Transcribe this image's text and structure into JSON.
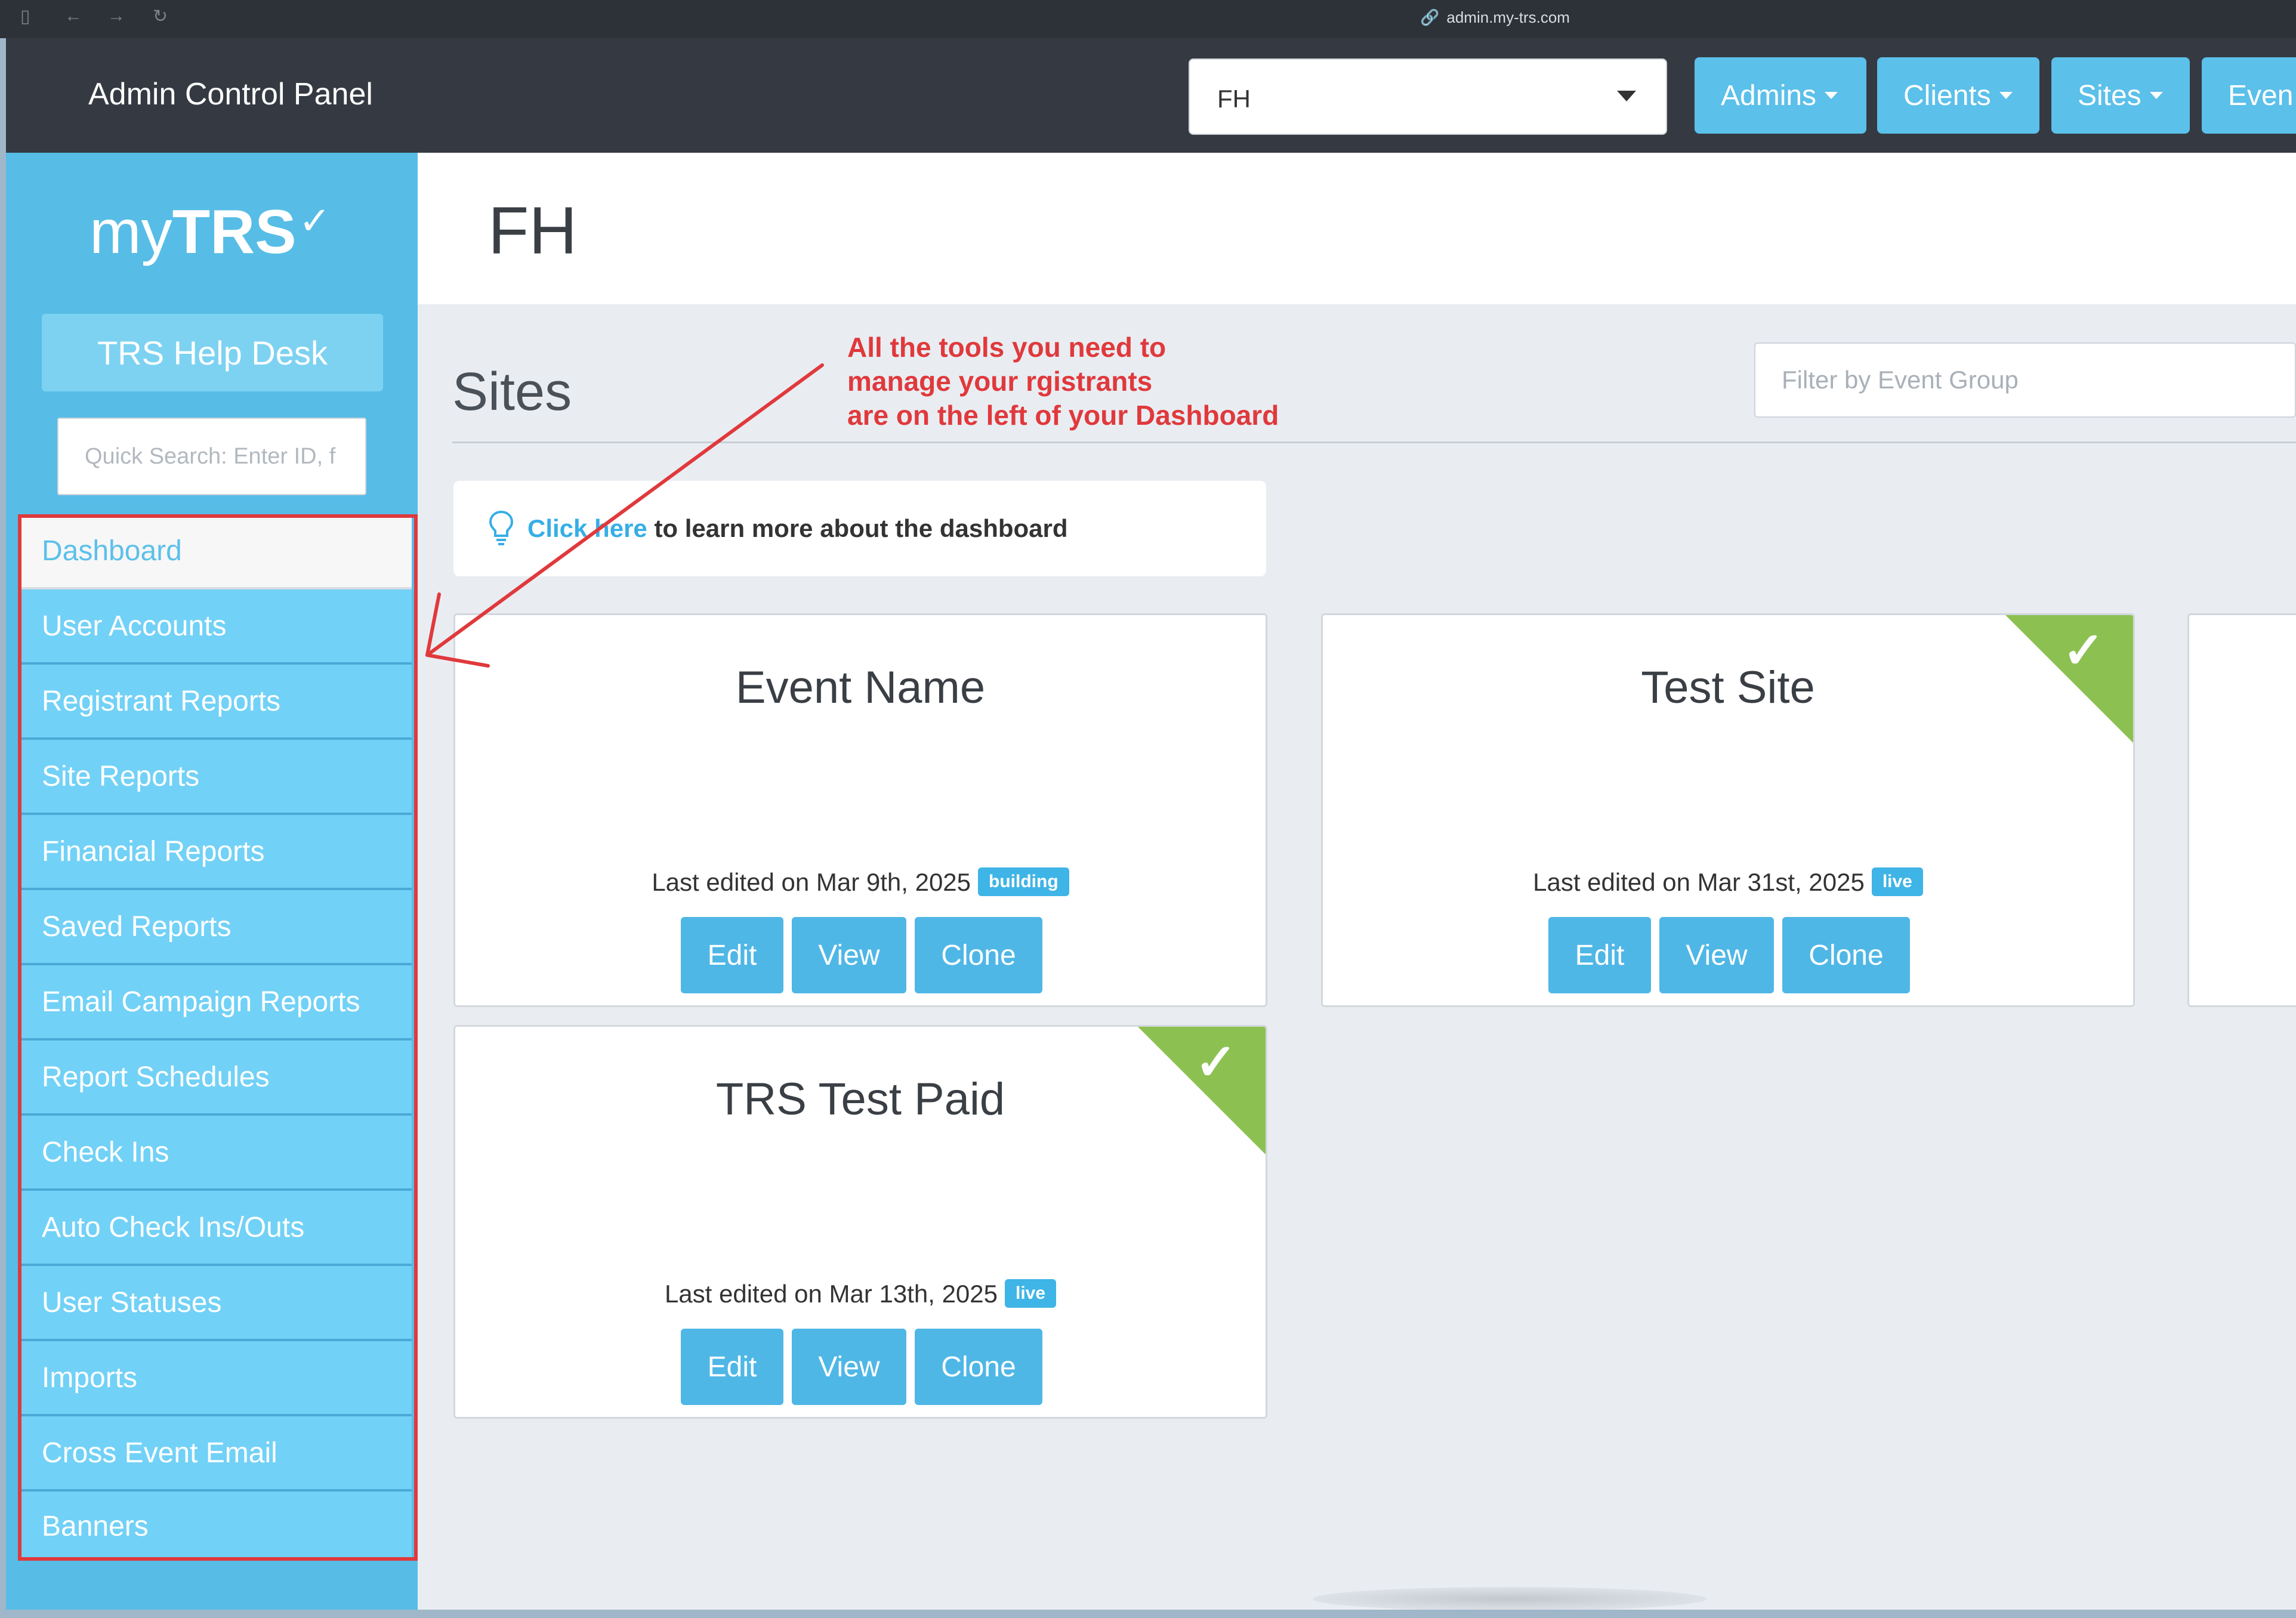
{
  "browser": {
    "url": "admin.my-trs.com"
  },
  "topbar": {
    "title": "Admin Control Panel",
    "client_select": "FH",
    "nav": [
      {
        "label": "Admins"
      },
      {
        "label": "Clients"
      },
      {
        "label": "Sites"
      },
      {
        "label": "Even"
      }
    ]
  },
  "sidebar": {
    "logo": {
      "my": "my",
      "trs": "TRS",
      "check": "✓"
    },
    "help_desk": "TRS Help Desk",
    "quick_search_placeholder": "Quick Search: Enter ID, f",
    "menu": [
      {
        "label": "Dashboard",
        "active": true
      },
      {
        "label": "User Accounts"
      },
      {
        "label": "Registrant Reports"
      },
      {
        "label": "Site Reports"
      },
      {
        "label": "Financial Reports"
      },
      {
        "label": "Saved Reports"
      },
      {
        "label": "Email Campaign Reports"
      },
      {
        "label": "Report Schedules"
      },
      {
        "label": "Check Ins"
      },
      {
        "label": "Auto Check Ins/Outs"
      },
      {
        "label": "User Statuses"
      },
      {
        "label": "Imports"
      },
      {
        "label": "Cross Event Email"
      },
      {
        "label": "Banners"
      }
    ]
  },
  "page": {
    "title": "FH",
    "sites_heading": "Sites",
    "filter_placeholder": "Filter by Event Group",
    "annotation": [
      "All the tools you need to",
      "manage your rgistrants",
      "are on the left of your Dashboard"
    ],
    "info": {
      "link": "Click here",
      "rest": " to learn more about the dashboard"
    },
    "cards": [
      {
        "title": "Event Name",
        "meta": "Last edited on Mar 9th, 2025",
        "status": "building",
        "checked": false
      },
      {
        "title": "Test Site",
        "meta": "Last edited on Mar 31st, 2025",
        "status": "live",
        "checked": true
      },
      {
        "title": "TRS Test Paid",
        "meta": "Last edited on Mar 13th, 2025",
        "status": "live",
        "checked": true
      }
    ],
    "card_buttons": {
      "edit": "Edit",
      "view": "View",
      "clone": "Clone"
    }
  },
  "colors": {
    "accent": "#5bc0ea",
    "sidebar": "#57bde6",
    "topbar": "#353a42",
    "annotation": "#e0393c",
    "check_corner": "#8cc152"
  }
}
